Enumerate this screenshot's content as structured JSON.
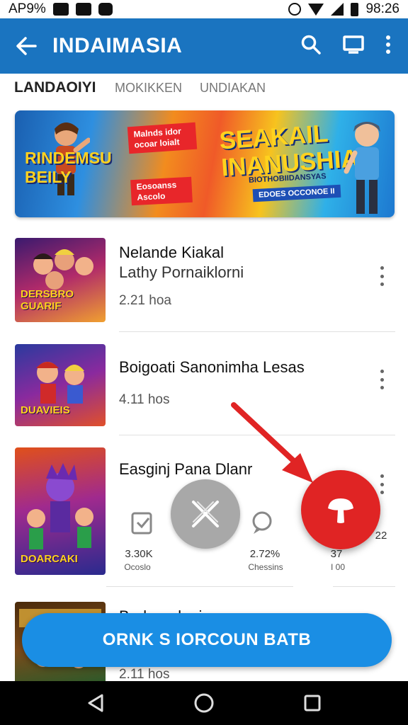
{
  "status_bar": {
    "left_text": "AP9%",
    "time": "98:26"
  },
  "app_bar": {
    "title": "INDAIMASIA",
    "icons": [
      "back-arrow-icon",
      "search-icon",
      "cast-icon",
      "more-vert-icon"
    ]
  },
  "tabs": [
    {
      "label": "LANDAOIYI",
      "active": true
    },
    {
      "label": "MOKIKKEN",
      "active": false
    },
    {
      "label": "UNDIAKAN",
      "active": false
    }
  ],
  "banner": {
    "left_title": "RINDEMSU BEILY",
    "badge_top": "Malnds idor ocoar loialt",
    "badge_bottom": "Eosoanss Ascolo",
    "title": "SEAKAIL INANUSHIA",
    "subtitle": "BIOTHOBIIDANSYAS",
    "tag": "EDOES OCCONOE II"
  },
  "items": [
    {
      "title": "Nelande Kiakal",
      "subtitle": "Lathy Pornaiklorni",
      "meta": "2.21 hoa",
      "thumb_label": "DERSBRO GUARIF"
    },
    {
      "title": "Boigoati Sanonimha Lesas",
      "subtitle": "",
      "meta": "4.11 hos",
      "thumb_label": "DUAVIEIS"
    },
    {
      "title": "Easginj Pana Dlanr",
      "subtitle": "",
      "meta": "",
      "thumb_label": "DOARCAKI"
    },
    {
      "title": "Bedaoudanir",
      "subtitle": "",
      "meta": "2.11 hos",
      "thumb_label": ""
    }
  ],
  "share_overlay": {
    "options": [
      {
        "value": "3.30K",
        "label": "Ocoslo"
      },
      {
        "value": "2.72%",
        "label": "Chessins"
      },
      {
        "value": "37",
        "label": "I 00"
      },
      {
        "value": "22",
        "label": ""
      }
    ]
  },
  "cta": {
    "label": "ORNK S IORCOUN BATB"
  },
  "colors": {
    "app_bar": "#1a74c0",
    "cta": "#1a8ee4",
    "red_fab": "#e02424",
    "close_fab": "#a8a8a8"
  }
}
